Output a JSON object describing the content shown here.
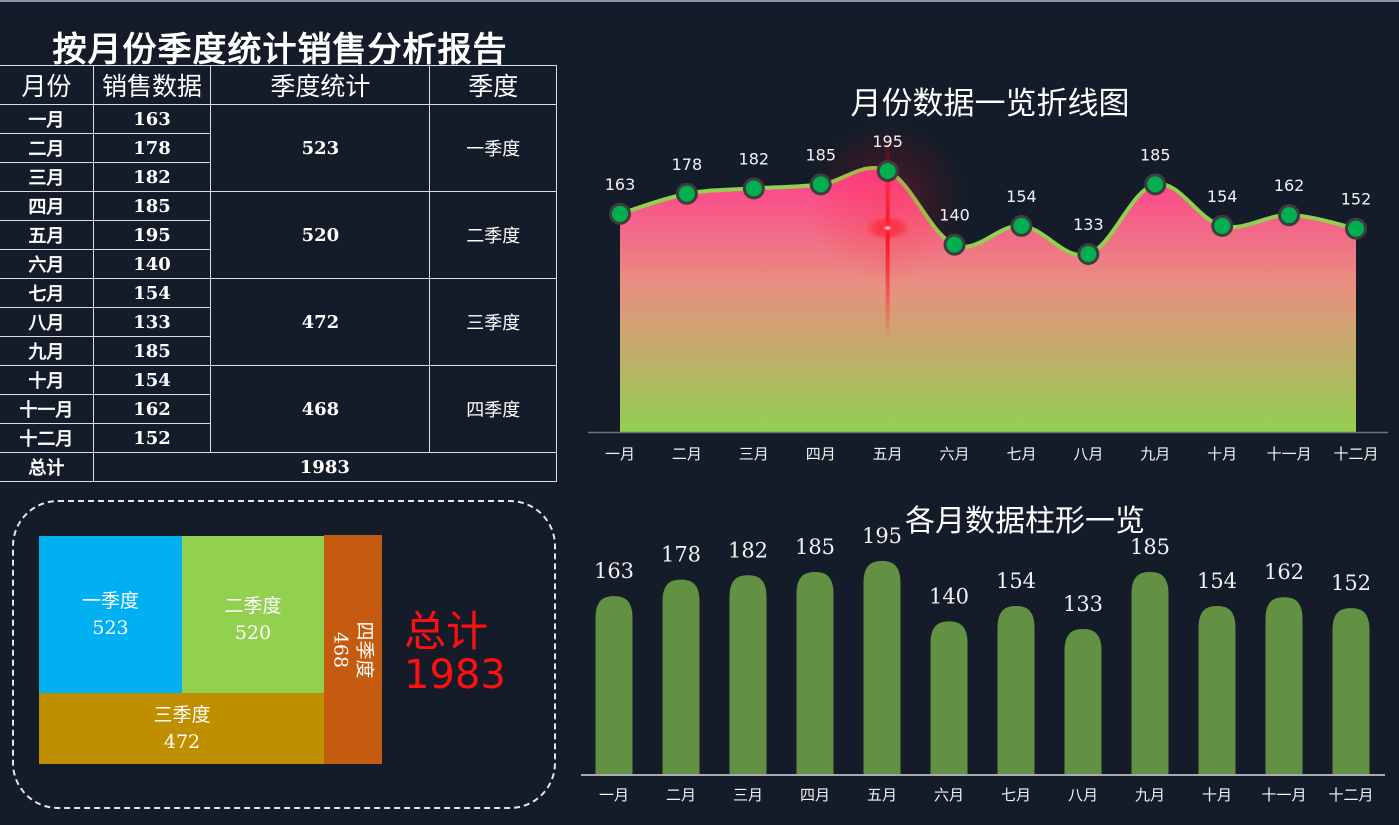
{
  "report": {
    "title": "按月份季度统计销售分析报告",
    "headers": [
      "月份",
      "销售数据",
      "季度统计",
      "季度"
    ],
    "rows": [
      {
        "month": "一月",
        "sales": "163"
      },
      {
        "month": "二月",
        "sales": "178"
      },
      {
        "month": "三月",
        "sales": "182"
      },
      {
        "month": "四月",
        "sales": "185"
      },
      {
        "month": "五月",
        "sales": "195"
      },
      {
        "month": "六月",
        "sales": "140"
      },
      {
        "month": "七月",
        "sales": "154"
      },
      {
        "month": "八月",
        "sales": "133"
      },
      {
        "month": "九月",
        "sales": "185"
      },
      {
        "month": "十月",
        "sales": "154"
      },
      {
        "month": "十一月",
        "sales": "162"
      },
      {
        "month": "十二月",
        "sales": "152"
      }
    ],
    "quarters": [
      {
        "name": "一季度",
        "sum": "523"
      },
      {
        "name": "二季度",
        "sum": "520"
      },
      {
        "name": "三季度",
        "sum": "472"
      },
      {
        "name": "四季度",
        "sum": "468"
      }
    ],
    "total_label": "总计",
    "total_value": "1983"
  },
  "treemap": {
    "total_label": "总计",
    "total_value": "1983",
    "colors": {
      "q1": "#00b0f0",
      "q2": "#92d050",
      "q3": "#bf8f00",
      "q4": "#c55a11",
      "total": "#ff0000"
    }
  },
  "chart_data": [
    {
      "type": "area",
      "title": "月份数据一览折线图",
      "categories": [
        "一月",
        "二月",
        "三月",
        "四月",
        "五月",
        "六月",
        "七月",
        "八月",
        "九月",
        "十月",
        "十一月",
        "十二月"
      ],
      "values": [
        163,
        178,
        182,
        185,
        195,
        140,
        154,
        133,
        185,
        154,
        162,
        152
      ],
      "xlabel": "",
      "ylabel": "",
      "ylim": [
        0,
        200
      ],
      "grid": false,
      "colors": {
        "line": "#92d050",
        "marker": "#00b050",
        "fill_top": "#ff3d8f",
        "fill_bottom": "#92d050",
        "highlight": "#ff2020"
      },
      "highlight_category": "五月"
    },
    {
      "type": "bar",
      "title": "各月数据柱形一览",
      "categories": [
        "一月",
        "二月",
        "三月",
        "四月",
        "五月",
        "六月",
        "七月",
        "八月",
        "九月",
        "十月",
        "十一月",
        "十二月"
      ],
      "values": [
        163,
        178,
        182,
        185,
        195,
        140,
        154,
        133,
        185,
        154,
        162,
        152
      ],
      "xlabel": "",
      "ylabel": "",
      "ylim": [
        0,
        195
      ],
      "grid": false,
      "colors": {
        "bar": "#639143"
      }
    }
  ]
}
